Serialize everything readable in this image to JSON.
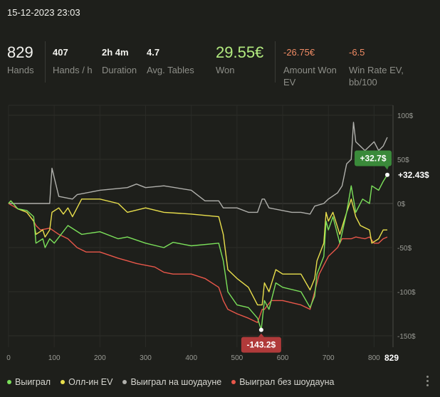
{
  "header": {
    "datetime": "15-12-2023 23:03"
  },
  "stats": {
    "hands": {
      "value": "829",
      "label": "Hands"
    },
    "hands_per_hour": {
      "value": "407",
      "label": "Hands / h"
    },
    "duration": {
      "value": "2h 4m",
      "label": "Duration"
    },
    "avg_tables": {
      "value": "4.7",
      "label": "Avg. Tables"
    },
    "won": {
      "value": "29.55€",
      "label": "Won"
    },
    "amount_won_ev": {
      "value": "-26.75€",
      "label_line1": "Amount Won",
      "label_line2": "EV"
    },
    "win_rate_ev": {
      "value": "-6.5",
      "label_line1": "Win Rate EV,",
      "label_line2": "bb/100"
    }
  },
  "colors": {
    "won": "#7be05a",
    "allin_ev": "#e9df4c",
    "showdown": "#b0b0ac",
    "non_showdown": "#e9574a",
    "max_badge": "#3a8a3a",
    "min_badge": "#b03a3a"
  },
  "chart_data": {
    "type": "line",
    "x_ticks": [
      0,
      100,
      200,
      300,
      400,
      500,
      600,
      700,
      800
    ],
    "x_tick_labels": [
      "0",
      "100",
      "200",
      "300",
      "400",
      "500",
      "600",
      "700",
      "800"
    ],
    "x_end_label": "829",
    "xlim": [
      0,
      829
    ],
    "y_ticks": [
      100,
      50,
      0,
      -50,
      -100,
      -150
    ],
    "y_tick_labels": [
      "100$",
      "50$",
      "0$",
      "-50$",
      "-100$",
      "-150$"
    ],
    "ylim": [
      -150,
      100
    ],
    "grid": true,
    "legend_position": "bottom-left",
    "series": [
      {
        "name": "Выиграл",
        "key": "won",
        "points": [
          [
            0,
            0
          ],
          [
            5,
            3
          ],
          [
            20,
            -6
          ],
          [
            40,
            -8
          ],
          [
            55,
            -15
          ],
          [
            60,
            -45
          ],
          [
            75,
            -40
          ],
          [
            80,
            -50
          ],
          [
            90,
            -40
          ],
          [
            100,
            -45
          ],
          [
            130,
            -25
          ],
          [
            160,
            -35
          ],
          [
            200,
            -32
          ],
          [
            240,
            -40
          ],
          [
            260,
            -38
          ],
          [
            300,
            -45
          ],
          [
            340,
            -50
          ],
          [
            360,
            -44
          ],
          [
            400,
            -48
          ],
          [
            460,
            -45
          ],
          [
            470,
            -65
          ],
          [
            480,
            -100
          ],
          [
            500,
            -115
          ],
          [
            525,
            -118
          ],
          [
            545,
            -130
          ],
          [
            553,
            -143.2
          ],
          [
            560,
            -110
          ],
          [
            570,
            -120
          ],
          [
            585,
            -90
          ],
          [
            600,
            -95
          ],
          [
            640,
            -100
          ],
          [
            660,
            -118
          ],
          [
            670,
            -105
          ],
          [
            675,
            -80
          ],
          [
            690,
            -60
          ],
          [
            695,
            -20
          ],
          [
            700,
            -30
          ],
          [
            710,
            -15
          ],
          [
            725,
            -45
          ],
          [
            740,
            -10
          ],
          [
            750,
            20
          ],
          [
            760,
            -10
          ],
          [
            775,
            5
          ],
          [
            790,
            0
          ],
          [
            795,
            20
          ],
          [
            810,
            15
          ],
          [
            820,
            25
          ],
          [
            829,
            32.43
          ]
        ]
      },
      {
        "name": "Олл-ин EV",
        "key": "allin_ev",
        "points": [
          [
            0,
            0
          ],
          [
            5,
            3
          ],
          [
            20,
            -6
          ],
          [
            40,
            -10
          ],
          [
            55,
            -20
          ],
          [
            60,
            -35
          ],
          [
            75,
            -30
          ],
          [
            80,
            -38
          ],
          [
            90,
            -30
          ],
          [
            95,
            -10
          ],
          [
            110,
            -5
          ],
          [
            120,
            -12
          ],
          [
            130,
            -5
          ],
          [
            140,
            -15
          ],
          [
            160,
            5
          ],
          [
            200,
            5
          ],
          [
            240,
            0
          ],
          [
            260,
            -10
          ],
          [
            300,
            -5
          ],
          [
            340,
            -10
          ],
          [
            400,
            -12
          ],
          [
            460,
            -15
          ],
          [
            470,
            -35
          ],
          [
            480,
            -75
          ],
          [
            500,
            -85
          ],
          [
            525,
            -95
          ],
          [
            545,
            -115
          ],
          [
            555,
            -115
          ],
          [
            560,
            -90
          ],
          [
            570,
            -100
          ],
          [
            585,
            -75
          ],
          [
            600,
            -80
          ],
          [
            640,
            -80
          ],
          [
            660,
            -98
          ],
          [
            670,
            -85
          ],
          [
            675,
            -65
          ],
          [
            690,
            -45
          ],
          [
            695,
            -10
          ],
          [
            700,
            -20
          ],
          [
            710,
            -10
          ],
          [
            725,
            -35
          ],
          [
            740,
            -10
          ],
          [
            750,
            5
          ],
          [
            760,
            -15
          ],
          [
            770,
            -25
          ],
          [
            790,
            -30
          ],
          [
            795,
            -45
          ],
          [
            810,
            -40
          ],
          [
            820,
            -30
          ],
          [
            829,
            -30
          ]
        ]
      },
      {
        "name": "Выиграл на шоудауне",
        "key": "showdown",
        "points": [
          [
            0,
            0
          ],
          [
            60,
            0
          ],
          [
            90,
            0
          ],
          [
            95,
            40
          ],
          [
            110,
            8
          ],
          [
            140,
            5
          ],
          [
            150,
            10
          ],
          [
            200,
            15
          ],
          [
            260,
            18
          ],
          [
            280,
            22
          ],
          [
            300,
            18
          ],
          [
            340,
            20
          ],
          [
            400,
            15
          ],
          [
            430,
            3
          ],
          [
            460,
            3
          ],
          [
            470,
            -5
          ],
          [
            500,
            -5
          ],
          [
            525,
            -10
          ],
          [
            545,
            -10
          ],
          [
            555,
            5
          ],
          [
            560,
            5
          ],
          [
            570,
            -5
          ],
          [
            600,
            -8
          ],
          [
            620,
            -10
          ],
          [
            640,
            -10
          ],
          [
            660,
            -12
          ],
          [
            670,
            -3
          ],
          [
            690,
            0
          ],
          [
            700,
            5
          ],
          [
            720,
            12
          ],
          [
            730,
            20
          ],
          [
            740,
            45
          ],
          [
            750,
            50
          ],
          [
            755,
            92
          ],
          [
            760,
            70
          ],
          [
            780,
            60
          ],
          [
            800,
            70
          ],
          [
            810,
            60
          ],
          [
            820,
            65
          ],
          [
            829,
            75
          ]
        ]
      },
      {
        "name": "Выиграл без шоудауна",
        "key": "non_showdown",
        "points": [
          [
            0,
            0
          ],
          [
            10,
            -3
          ],
          [
            20,
            -6
          ],
          [
            40,
            -10
          ],
          [
            55,
            -20
          ],
          [
            60,
            -25
          ],
          [
            70,
            -30
          ],
          [
            90,
            -28
          ],
          [
            110,
            -35
          ],
          [
            130,
            -40
          ],
          [
            150,
            -50
          ],
          [
            170,
            -55
          ],
          [
            200,
            -55
          ],
          [
            240,
            -62
          ],
          [
            260,
            -65
          ],
          [
            280,
            -68
          ],
          [
            300,
            -70
          ],
          [
            320,
            -72
          ],
          [
            340,
            -78
          ],
          [
            360,
            -80
          ],
          [
            400,
            -80
          ],
          [
            430,
            -85
          ],
          [
            460,
            -95
          ],
          [
            470,
            -110
          ],
          [
            480,
            -120
          ],
          [
            500,
            -125
          ],
          [
            525,
            -130
          ],
          [
            545,
            -135
          ],
          [
            555,
            -120
          ],
          [
            560,
            -120
          ],
          [
            575,
            -110
          ],
          [
            600,
            -110
          ],
          [
            640,
            -115
          ],
          [
            660,
            -120
          ],
          [
            670,
            -100
          ],
          [
            680,
            -80
          ],
          [
            690,
            -70
          ],
          [
            700,
            -60
          ],
          [
            720,
            -50
          ],
          [
            730,
            -40
          ],
          [
            750,
            -40
          ],
          [
            760,
            -38
          ],
          [
            780,
            -40
          ],
          [
            790,
            -38
          ],
          [
            800,
            -45
          ],
          [
            810,
            -45
          ],
          [
            820,
            -40
          ],
          [
            829,
            -38
          ]
        ]
      }
    ],
    "max_annotation": {
      "label": "+32.7$",
      "x": 829,
      "y": 32.7
    },
    "end_annotation": {
      "label": "+32.43$",
      "x": 829,
      "y": 32.43
    },
    "min_annotation": {
      "label": "-143.2$",
      "x": 553,
      "y": -143.2
    }
  }
}
